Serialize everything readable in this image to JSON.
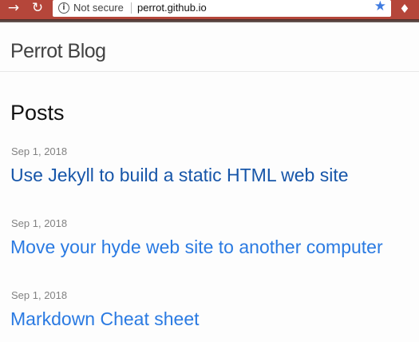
{
  "browser": {
    "back_icon": "→",
    "reload_icon": "↻",
    "info_icon": "i",
    "security_label": "Not secure",
    "url": "perrot.github.io",
    "bookmark_icon": "★",
    "extension_icon": "♦"
  },
  "header": {
    "site_title": "Perrot Blog"
  },
  "main": {
    "heading": "Posts",
    "posts": [
      {
        "date": "Sep 1, 2018",
        "title": "Use Jekyll to build a static HTML web site"
      },
      {
        "date": "Sep 1, 2018",
        "title": "Move your hyde web site to another computer"
      },
      {
        "date": "Sep 1, 2018",
        "title": "Markdown Cheat sheet"
      }
    ]
  },
  "colors": {
    "browser_bar": "#b5463a",
    "link": "#2a7ae2",
    "link_visited": "#1756a9",
    "date": "#828282"
  }
}
